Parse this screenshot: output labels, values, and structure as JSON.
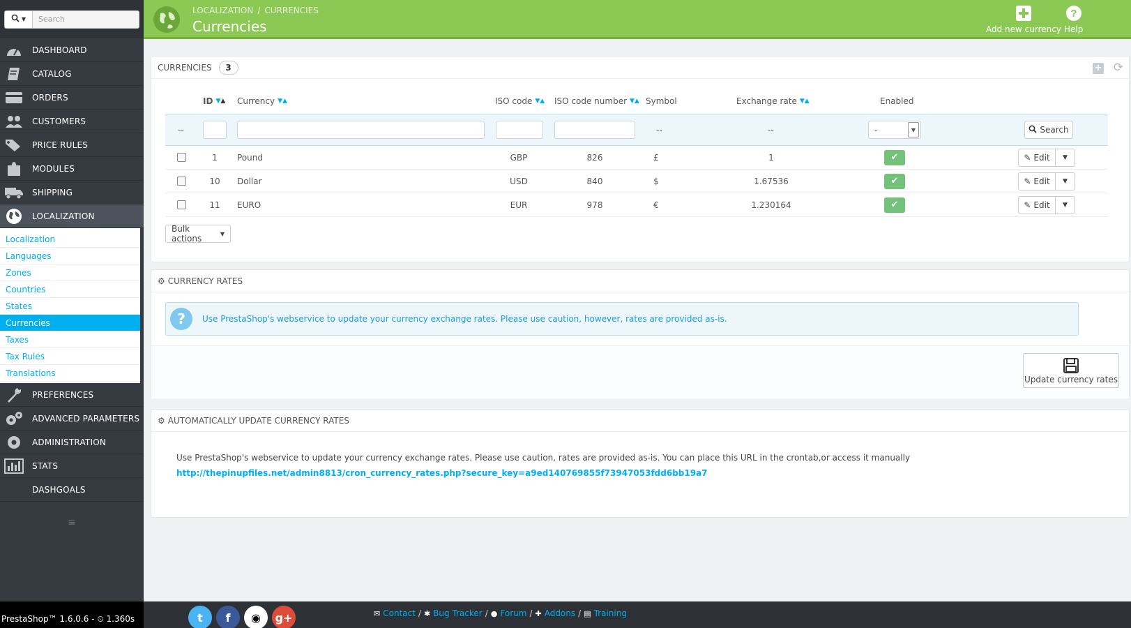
{
  "sidebar": {
    "search_placeholder": "Search",
    "nav": [
      {
        "label": "DASHBOARD",
        "icon": "dashboard-icon"
      },
      {
        "label": "CATALOG",
        "icon": "book-icon"
      },
      {
        "label": "ORDERS",
        "icon": "credit-card-icon"
      },
      {
        "label": "CUSTOMERS",
        "icon": "users-icon"
      },
      {
        "label": "PRICE RULES",
        "icon": "tags-icon"
      },
      {
        "label": "MODULES",
        "icon": "puzzle-icon"
      },
      {
        "label": "SHIPPING",
        "icon": "truck-icon"
      },
      {
        "label": "LOCALIZATION",
        "icon": "globe-icon"
      }
    ],
    "submenu": [
      "Localization",
      "Languages",
      "Zones",
      "Countries",
      "States",
      "Currencies",
      "Taxes",
      "Tax Rules",
      "Translations"
    ],
    "nav_bottom": [
      {
        "label": "PREFERENCES",
        "icon": "wrench-icon"
      },
      {
        "label": "ADVANCED PARAMETERS",
        "icon": "cogs-icon"
      },
      {
        "label": "ADMINISTRATION",
        "icon": "cog-icon"
      },
      {
        "label": "STATS",
        "icon": "bar-chart-icon"
      },
      {
        "label": "DASHGOALS",
        "icon": ""
      }
    ],
    "version": "PrestaShop™ 1.6.0.6 - ",
    "load_time": "1.360s"
  },
  "header": {
    "breadcrumb": [
      "LOCALIZATION",
      "CURRENCIES"
    ],
    "title": "Currencies",
    "add_label": "Add new currency",
    "help_label": "Help"
  },
  "currencies_panel": {
    "title": "CURRENCIES",
    "count": "3",
    "columns": {
      "id": "ID",
      "currency": "Currency",
      "iso": "ISO code",
      "iso_number": "ISO code number",
      "symbol": "Symbol",
      "rate": "Exchange rate",
      "enabled": "Enabled"
    },
    "filter": {
      "placeholder_dash": "--",
      "symbol_dash": "--",
      "rate_dash": "--",
      "enabled_value": "-",
      "search_label": "Search"
    },
    "rows": [
      {
        "id": "1",
        "currency": "Pound",
        "iso": "GBP",
        "iso_number": "826",
        "symbol": "£",
        "rate": "1",
        "edit": "Edit"
      },
      {
        "id": "10",
        "currency": "Dollar",
        "iso": "USD",
        "iso_number": "840",
        "symbol": "$",
        "rate": "1.67536",
        "edit": "Edit"
      },
      {
        "id": "11",
        "currency": "EURO",
        "iso": "EUR",
        "iso_number": "978",
        "symbol": "€",
        "rate": "1.230164",
        "edit": "Edit"
      }
    ],
    "bulk_label": "Bulk actions"
  },
  "rates_panel": {
    "title": "CURRENCY RATES",
    "info": "Use PrestaShop's webservice to update your currency exchange rates. Please use caution, however, rates are provided as-is.",
    "update_label": "Update currency rates"
  },
  "auto_panel": {
    "title": "AUTOMATICALLY UPDATE CURRENCY RATES",
    "text": "Use PrestaShop's webservice to update your currency exchange rates. Please use caution, rates are provided as-is. You can place this URL in the crontab,or access it manually",
    "url": "http://thepinupfiles.net/admin8813/cron_currency_rates.php?secure_key=a9ed140769855f73947053fdd6bb19a7"
  },
  "footer": {
    "links": [
      "Contact",
      "Bug Tracker",
      "Forum",
      "Addons",
      "Training"
    ]
  },
  "colors": {
    "header_green": "#8bc954",
    "sidebar_dark": "#363a41",
    "accent_blue": "#00aff0",
    "enabled_green": "#72c279"
  }
}
